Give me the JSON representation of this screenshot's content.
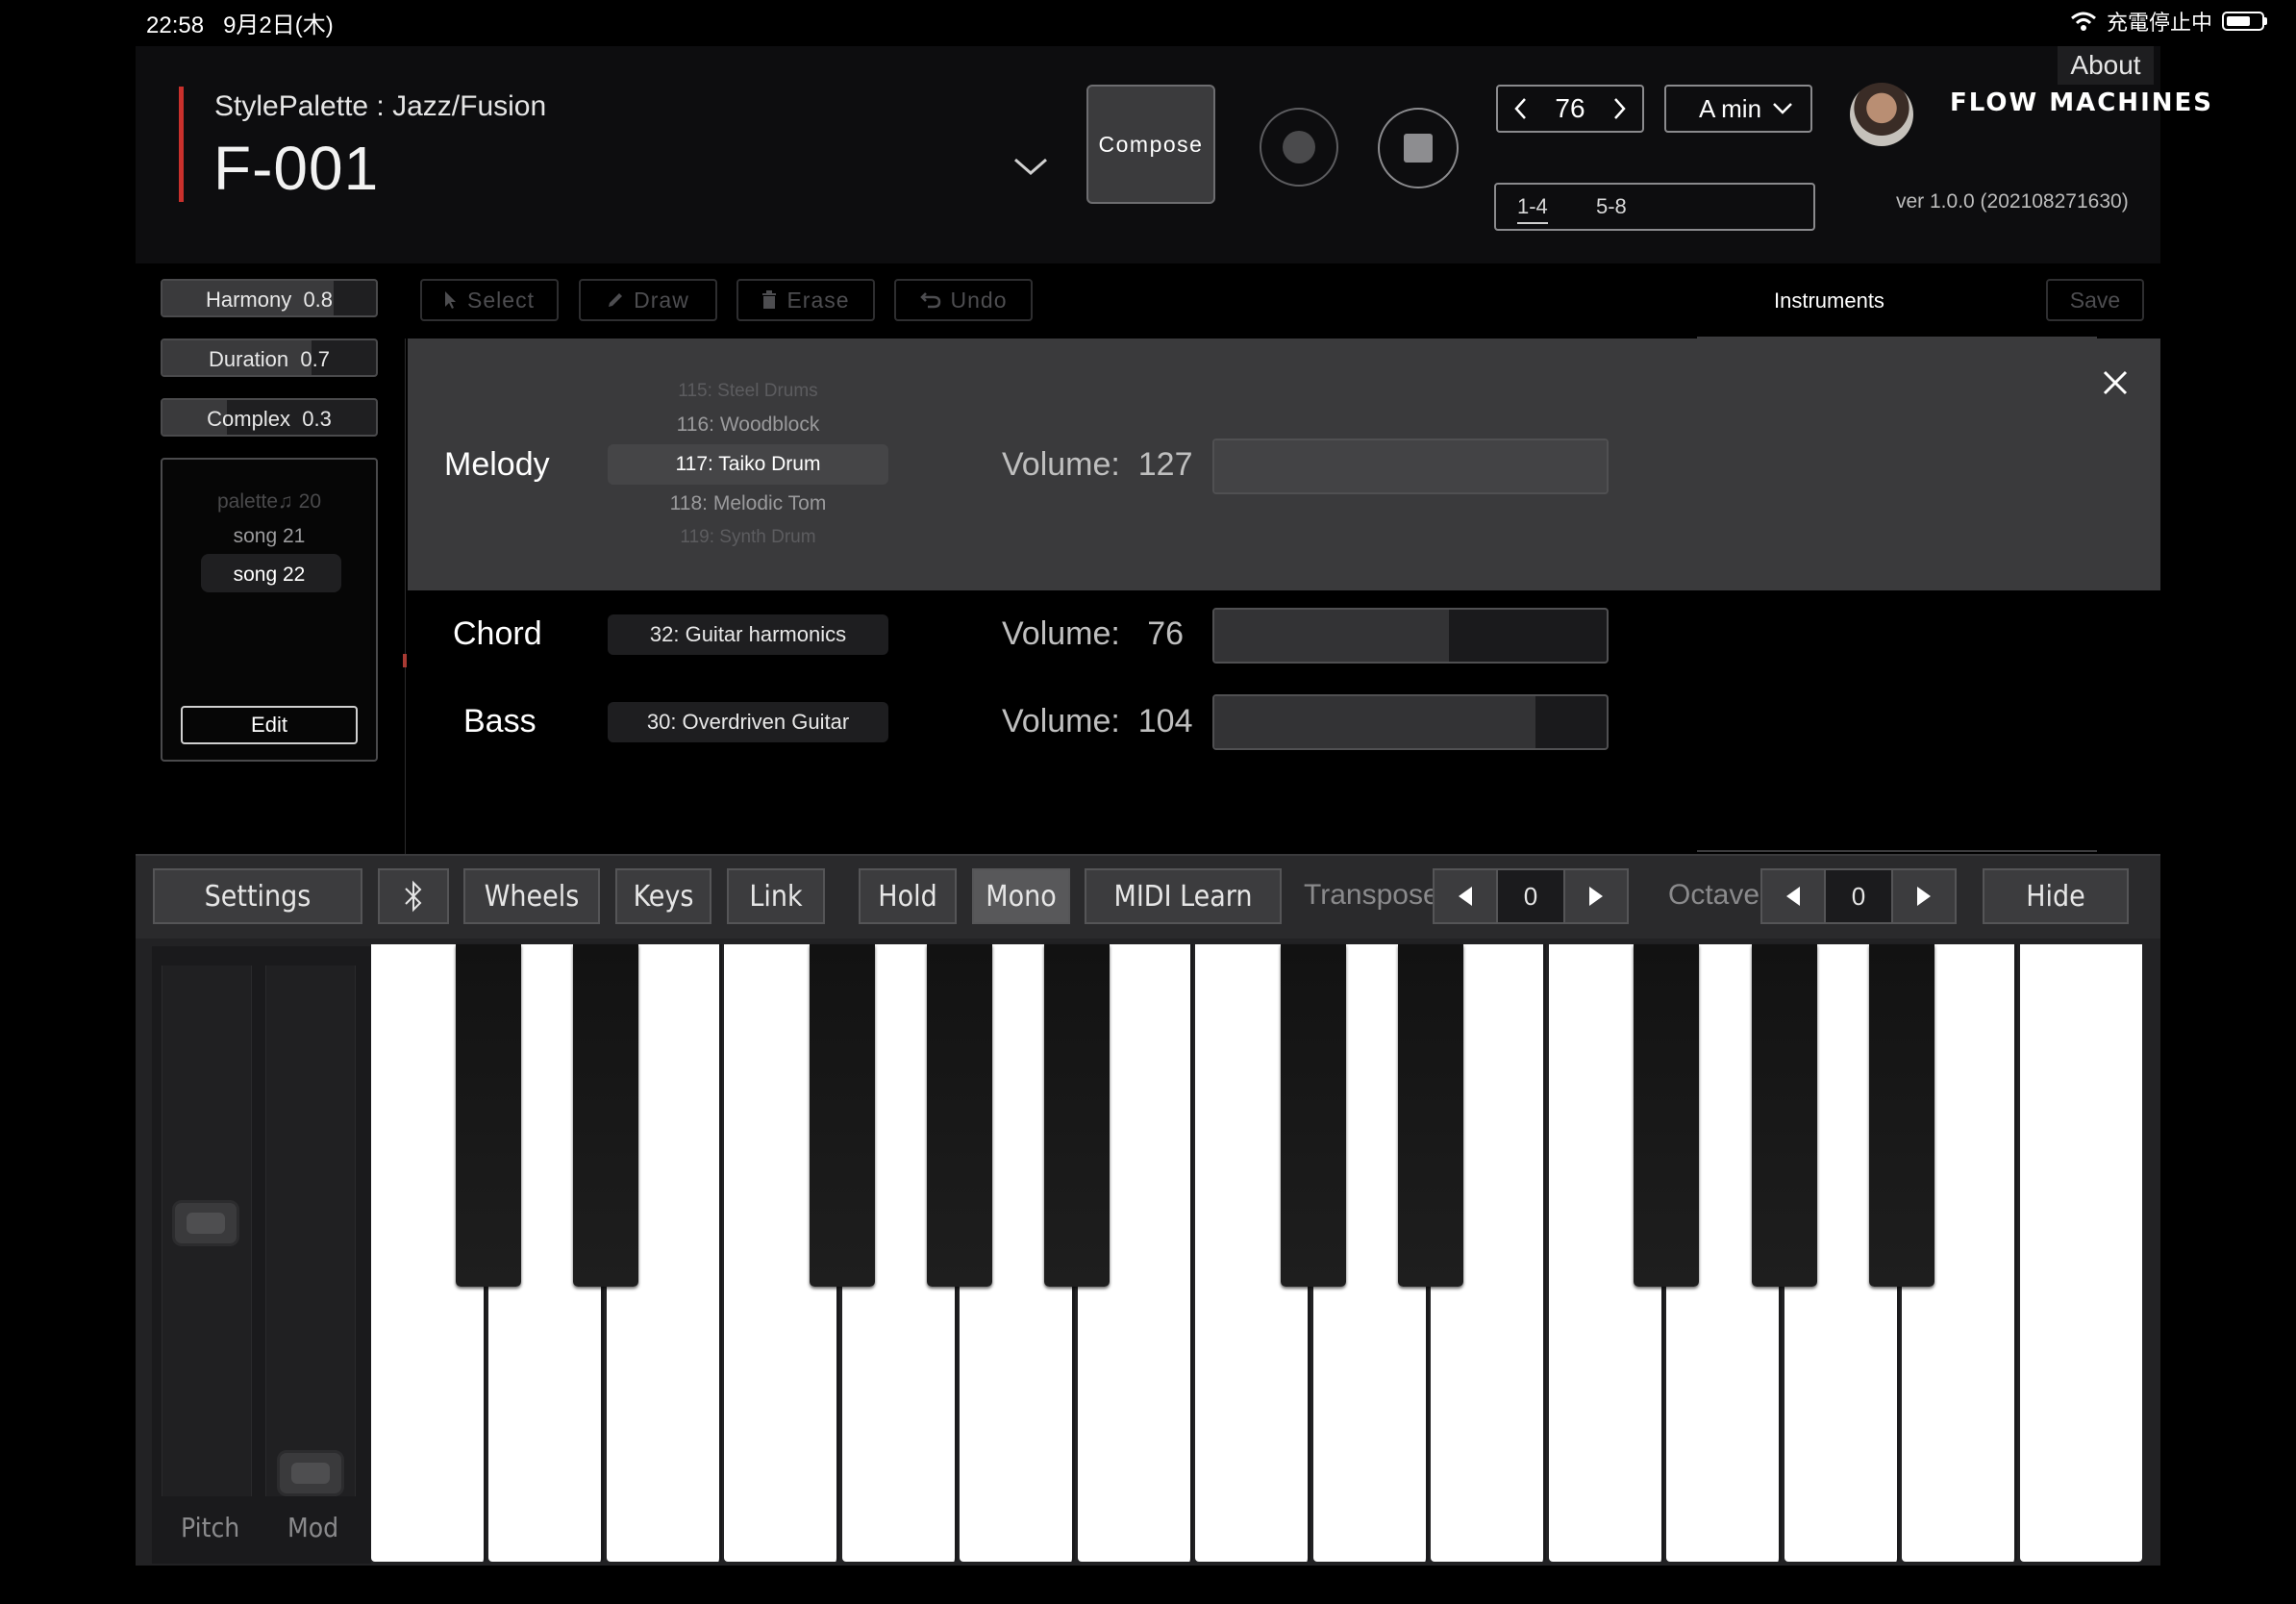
{
  "status": {
    "time": "22:58",
    "date": "9月2日(木)",
    "charging": "充電停止中"
  },
  "header": {
    "style_label": "StylePalette : Jazz/Fusion",
    "song_title": "F-001",
    "compose_label": "Compose",
    "tempo": "76",
    "key": "A min",
    "bars": [
      "1-4",
      "5-8"
    ],
    "logo": "FLOW MACHINES",
    "about": "About",
    "version": "ver 1.0.0 (202108271630)"
  },
  "params": [
    {
      "label": "Harmony",
      "value": "0.8",
      "level": 0.8
    },
    {
      "label": "Duration",
      "value": "0.7",
      "level": 0.7
    },
    {
      "label": "Complex",
      "value": "0.3",
      "level": 0.3
    }
  ],
  "songs": {
    "items": [
      "palette♫ 20",
      "song 21",
      "song 22"
    ],
    "selected": "song 22",
    "edit_label": "Edit"
  },
  "toolbar": {
    "select": "Select",
    "draw": "Draw",
    "erase": "Erase",
    "undo": "Undo",
    "instruments": "Instruments",
    "save": "Save"
  },
  "instruments": {
    "volume_label": "Volume:",
    "melody": {
      "name": "Melody",
      "options": [
        "115: Steel Drums",
        "116: Woodblock",
        "117: Taiko Drum",
        "118: Melodic Tom",
        "119: Synth Drum"
      ],
      "selected": "117: Taiko Drum",
      "volume": "127",
      "volume_level": 1.0
    },
    "chord": {
      "name": "Chord",
      "program": "32: Guitar harmonics",
      "volume": "76",
      "volume_level": 0.598
    },
    "bass": {
      "name": "Bass",
      "program": "30: Overdriven Guitar",
      "volume": "104",
      "volume_level": 0.819
    }
  },
  "keyboard": {
    "settings": "Settings",
    "wheels": "Wheels",
    "keys": "Keys",
    "link": "Link",
    "hold": "Hold",
    "mono": "Mono",
    "midi_learn": "MIDI Learn",
    "transpose_label": "Transpose:",
    "transpose_value": "0",
    "octave_label": "Octave:",
    "octave_value": "0",
    "hide": "Hide",
    "pitch_label": "Pitch",
    "mod_label": "Mod"
  },
  "icons": {
    "bluetooth": "bluetooth-icon",
    "close": "close-icon",
    "chevron": "chevron-down-icon"
  },
  "colors": {
    "accent_red": "#c9302c",
    "background": "#000000",
    "panel": "#3a3a3c"
  }
}
